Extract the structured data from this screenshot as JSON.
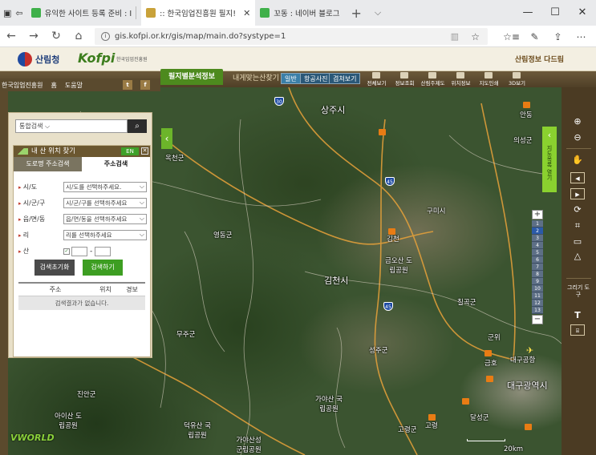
{
  "browser": {
    "tabs": [
      {
        "label": "유익한 사이트 등록 준비 : I",
        "color": "#3fb04a"
      },
      {
        "label": ":: 한국임업진흥원 필지!",
        "color": "#c9a23a"
      },
      {
        "label": "꼬동 : 네이버 블로그",
        "color": "#3fb04a"
      }
    ],
    "new_tab": "+",
    "chevron": "⌵",
    "controls": [
      "—",
      "☐",
      "✕"
    ],
    "url": "gis.kofpi.or.kr/gis/map/main.do?systype=1",
    "nav": [
      "←",
      "→",
      "↻",
      "⌂"
    ]
  },
  "header": {
    "gov_logo": "산림청",
    "brand": "Kofpi",
    "brand_sub": "한국임업진흥원",
    "right_logo": "산림정보 다드림"
  },
  "menu": {
    "primary": "필지별분석정보",
    "secondary": "내게맞는산찾기",
    "map_types": [
      "일반",
      "항공사진",
      "겹쳐보기"
    ],
    "tools": [
      "전체보기",
      "정보조회",
      "산림주제도",
      "위치정보",
      "지도인쇄",
      "3D보기"
    ]
  },
  "leftbar": {
    "site": "한국임업진흥원",
    "home": "홈",
    "help": "도움말",
    "twitter": "t",
    "facebook": "f"
  },
  "search": {
    "select_label": "통합검색",
    "button": "🔍"
  },
  "finder": {
    "title": "내 산 위치 찾기",
    "en": "EN",
    "close": "✕",
    "tabs": [
      "도로명 주소검색",
      "주소검색"
    ],
    "rows": [
      {
        "label": "시/도",
        "value": "시/도를 선택하주세요."
      },
      {
        "label": "시/군/구",
        "value": "시/군/구를 선택하주세요"
      },
      {
        "label": "읍/면/동",
        "value": "읍/면/동을 선택하주세요"
      },
      {
        "label": "리",
        "value": "리를 선택하주세요"
      }
    ],
    "mountain_label": "산",
    "reset": "검색초기화",
    "submit": "검색하기",
    "columns": [
      "주소",
      "위치",
      "경보"
    ],
    "empty": "검색결과가 없습니다."
  },
  "map": {
    "places": [
      "상주시",
      "옥천군",
      "영동군",
      "구미시",
      "김천",
      "금오산 도립공원",
      "칠곡군",
      "김천시",
      "무주군",
      "성주군",
      "대구공항",
      "대구광역시",
      "진안군",
      "가야산 국립공원",
      "아이산 도립공원",
      "달성군",
      "고령군",
      "덕유산 국립공원",
      "가야산성 군립공원",
      "의성군",
      "안동",
      "군위",
      "고령",
      "금호",
      "20km"
    ],
    "highways": [
      "30",
      "45",
      "45"
    ],
    "zoom_levels": [
      "1",
      "2",
      "3",
      "4",
      "5",
      "6",
      "7",
      "8",
      "9",
      "10",
      "11",
      "12",
      "13"
    ],
    "selected_zoom": 2,
    "side_collapse_label": "지도목록 열기",
    "vworld": "VWORLD"
  },
  "right_toolbar": {
    "draw_label": "그리기 도구",
    "icons": [
      "zoom-in",
      "zoom-out",
      "pan",
      "prev",
      "next",
      "refresh",
      "crop",
      "measure-distance",
      "measure-area"
    ],
    "text_tool": "T"
  }
}
